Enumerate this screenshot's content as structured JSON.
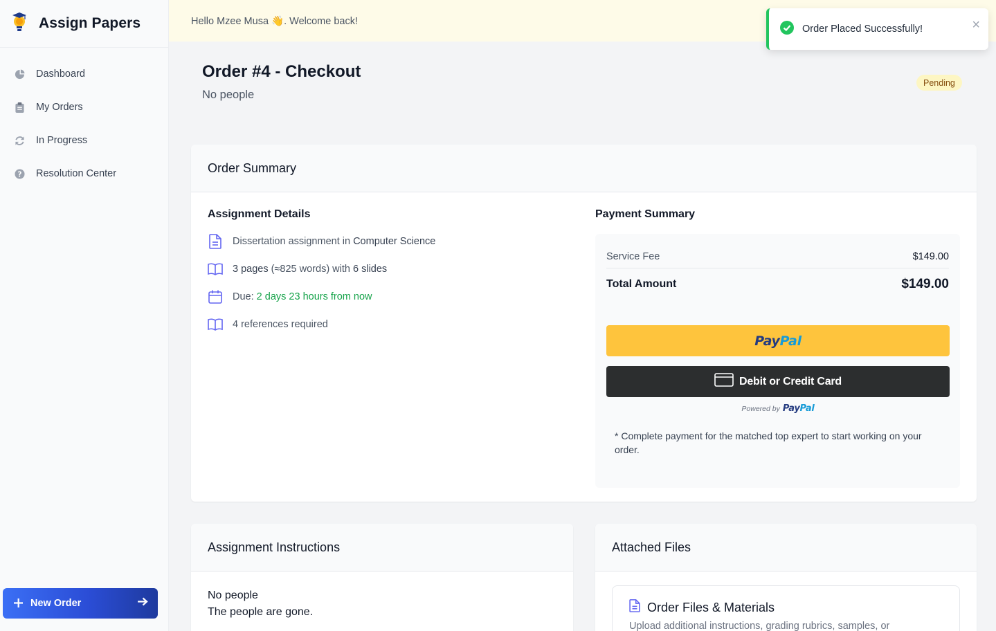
{
  "brand": {
    "name": "Assign Papers"
  },
  "sidebar": {
    "items": [
      {
        "label": "Dashboard",
        "icon": "pie-chart-icon"
      },
      {
        "label": "My Orders",
        "icon": "clipboard-icon"
      },
      {
        "label": "In Progress",
        "icon": "refresh-icon"
      },
      {
        "label": "Resolution Center",
        "icon": "question-circle-icon"
      }
    ],
    "new_order_label": "New Order"
  },
  "topbar": {
    "greeting": "Hello Mzee Musa 👋. Welcome back!"
  },
  "toast": {
    "message": "Order Placed Successfully!",
    "close": "×"
  },
  "page": {
    "title": "Order #4 - Checkout",
    "subtitle": "No people",
    "status": "Pending"
  },
  "summary": {
    "header": "Order Summary",
    "assignment_title": "Assignment Details",
    "details": {
      "type_prefix": "Dissertation assignment in ",
      "subject": "Computer Science",
      "pages": "3 pages",
      "words": " (≈825 words) with ",
      "slides": "6 slides",
      "due_prefix": "Due: ",
      "due_value": "2 days 23 hours from now",
      "references": "4 references required"
    },
    "payment_title": "Payment Summary",
    "service_fee_label": "Service Fee",
    "service_fee_value": "$149.00",
    "total_label": "Total Amount",
    "total_value": "$149.00",
    "paypal_pay": "Pay",
    "paypal_pal": "Pal",
    "card_button_label": "Debit or Credit Card",
    "powered_by": "Powered by",
    "note": "* Complete payment for the matched top expert to start working on your order."
  },
  "instructions": {
    "header": "Assignment Instructions",
    "line1": "No people",
    "line2": "The people are gone."
  },
  "attached": {
    "header": "Attached Files",
    "box_title": "Order Files & Materials",
    "box_subtitle": "Upload additional instructions, grading rubrics, samples, or"
  },
  "colors": {
    "accent": "#3b6ff5",
    "success": "#22c55e",
    "paypal_yellow": "#fec43d",
    "paypal_dark": "#2c2e2f",
    "pending_badge": "#fdf6c3",
    "detail_icon": "#6366f1"
  }
}
